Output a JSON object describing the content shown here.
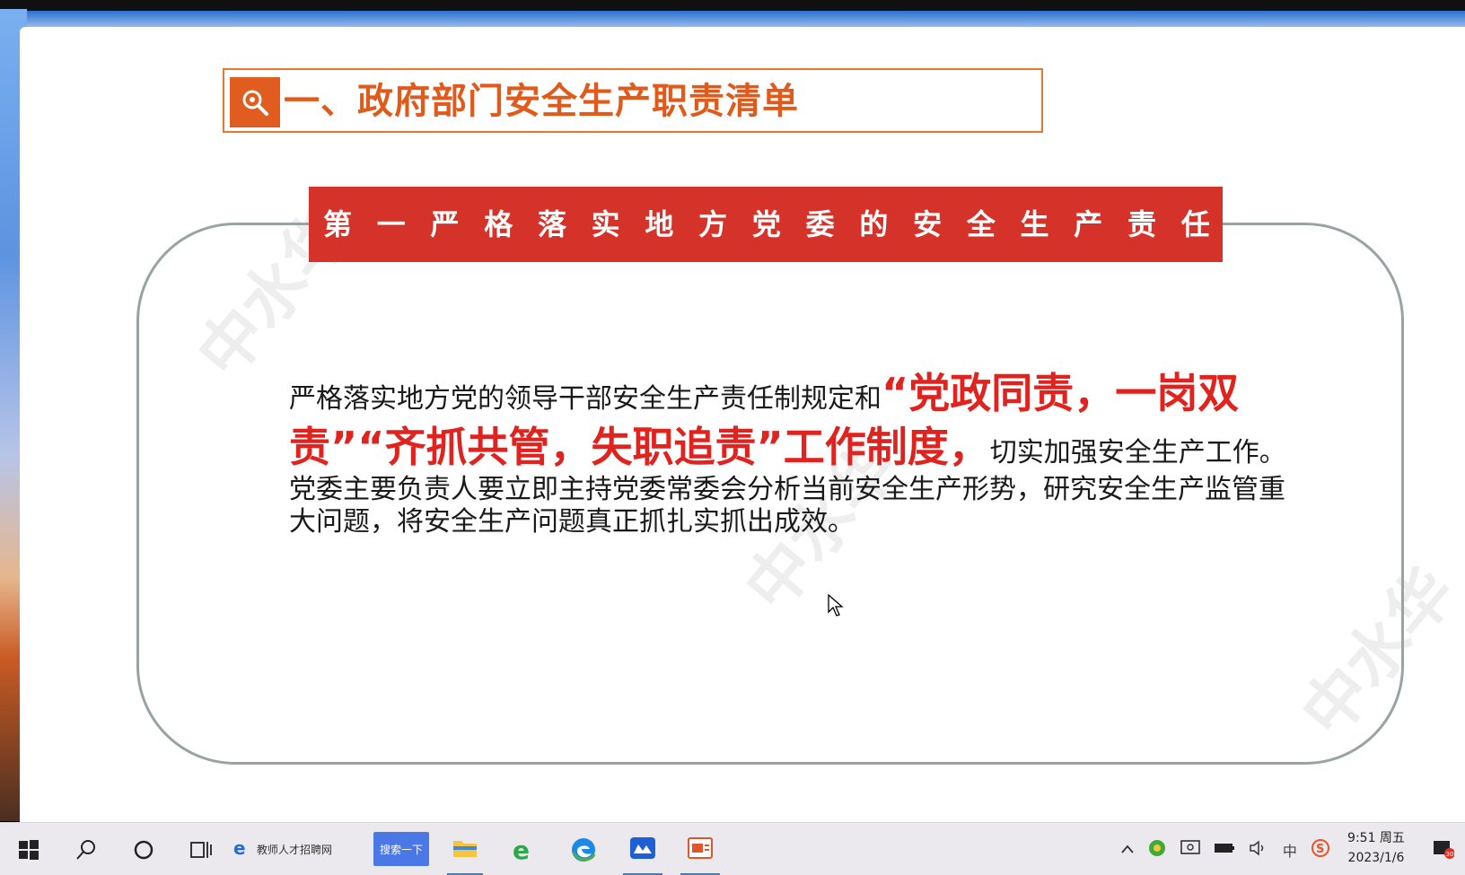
{
  "slide": {
    "title": "一、政府部门安全生产职责清单",
    "banner_chars": [
      "第",
      "一",
      "严",
      "格",
      "落",
      "实",
      "地",
      "方",
      "党",
      "委",
      "的",
      "安",
      "全",
      "生",
      "产",
      "责",
      "任"
    ],
    "body": {
      "part1": "严格落实地方党的领导干部安全生产责任制规定和",
      "highlight": "“党政同责，一岗双责”“齐抓共管，失职追责”工作制度，",
      "part2": "切实加强安全生产工作。党委主要负责人要立即主持党委常委会分析当前安全生产形势，研究安全生产监管重大问题，将安全生产问题真正抓扎实抓出成效。"
    },
    "watermark": "中水华",
    "colors": {
      "title": "#e05a1c",
      "banner": "#d5332a",
      "highlight": "#e0231e"
    }
  },
  "taskbar": {
    "ie_tab_label": "教师人才招聘网",
    "search_button_label": "搜索一下",
    "icons": [
      "windows-start-icon",
      "search-icon",
      "cortana-icon",
      "task-view-icon",
      "ie-icon",
      "file-explorer-icon",
      "ie-green-icon",
      "edge-icon",
      "app-icon",
      "powerpoint-icon"
    ],
    "tray_icons": [
      "chevron-up-icon",
      "security-icon",
      "display-icon",
      "battery-icon",
      "volume-icon",
      "ime-icon",
      "sogou-icon"
    ],
    "ime_label": "中",
    "clock_time": "9:51 周五",
    "clock_date": "2023/1/6",
    "notification_count": "30"
  }
}
